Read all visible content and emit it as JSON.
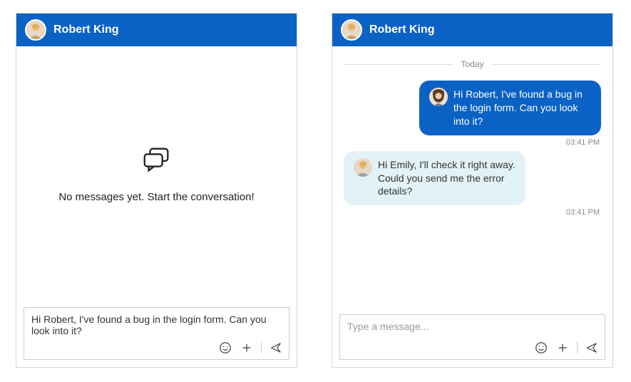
{
  "contact_name": "Robert King",
  "empty_state_text": "No messages yet. Start the conversation!",
  "day_label": "Today",
  "composer_left_value": "Hi Robert, I've found a bug in the login form. Can you look into it?",
  "composer_right_placeholder": "Type a message...",
  "messages": [
    {
      "direction": "sent",
      "text": "Hi Robert, I've found a bug in the login form. Can you look into it?",
      "time": "03:41 PM"
    },
    {
      "direction": "received",
      "text": "Hi Emily, I'll check it right away. Could you send me the error details?",
      "time": "03:41 PM"
    }
  ],
  "icons": {
    "emoji": "emoji-icon",
    "attach": "plus-icon",
    "send": "send-icon",
    "chat": "chat-bubble-icon"
  }
}
